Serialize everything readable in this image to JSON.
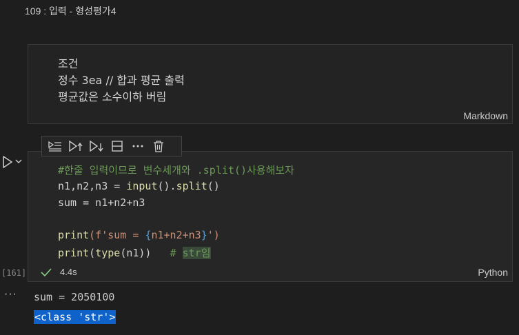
{
  "notebook": {
    "title": "109 : 입력 - 형성평가4"
  },
  "markdown_cell": {
    "lines": [
      "조건",
      "정수 3ea // 합과 평균 출력",
      "평균값은 소수이하 버림"
    ],
    "language": "Markdown"
  },
  "toolbar": {
    "items": [
      {
        "name": "run-by-line-icon"
      },
      {
        "name": "execute-above-icon"
      },
      {
        "name": "execute-below-icon"
      },
      {
        "name": "split-cell-icon"
      },
      {
        "name": "more-actions-icon"
      },
      {
        "name": "delete-icon"
      }
    ]
  },
  "code_cell": {
    "execution_count": "[161]",
    "status_time": "4.4s",
    "language": "Python",
    "lines": {
      "l1": "#한줄 입력이므로 변수세개와 .split()사용해보자",
      "l2a": "n1,n2,n3 = ",
      "l2b": "input",
      "l2c": "().",
      "l2d": "split",
      "l2e": "()",
      "l3": "sum = n1+n2+n3",
      "l5a": "print",
      "l5b": "(f'sum = ",
      "l5c": "{",
      "l5d": "n1+n2+n3",
      "l5e": "}",
      "l5f": "')",
      "l6a": "print",
      "l6b": "(",
      "l6c": "type",
      "l6d": "(n1))   ",
      "l6e": "# ",
      "l6f": "str임"
    }
  },
  "output": {
    "dots": "···",
    "lines": [
      "sum = 2050100",
      "<class 'str'>"
    ]
  },
  "colors": {
    "background": "#1e1e1e",
    "comment": "#6a9955",
    "function": "#dcdcaa",
    "string": "#ce9178",
    "keyword_brace": "#569cd6",
    "check": "#89d185",
    "selection": "#0e62c9"
  }
}
